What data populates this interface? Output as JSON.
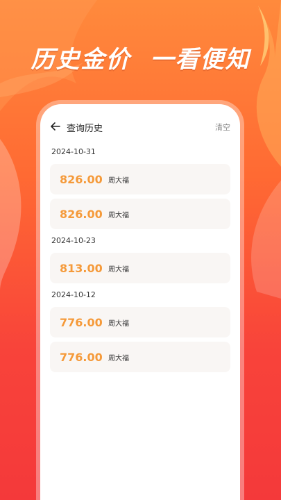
{
  "headline": {
    "part1": "历史金价",
    "part2": "一看便知"
  },
  "topbar": {
    "title": "查询历史",
    "clear_label": "清空"
  },
  "history": [
    {
      "date": "2024-10-31",
      "items": [
        {
          "price": "826.00",
          "brand": "周大福"
        },
        {
          "price": "826.00",
          "brand": "周大福"
        }
      ]
    },
    {
      "date": "2024-10-23",
      "items": [
        {
          "price": "813.00",
          "brand": "周大福"
        }
      ]
    },
    {
      "date": "2024-10-12",
      "items": [
        {
          "price": "776.00",
          "brand": "周大福"
        },
        {
          "price": "776.00",
          "brand": "周大福"
        }
      ]
    }
  ],
  "colors": {
    "price": "#f59a3a",
    "bg_top": "#ff8a3c",
    "bg_bottom": "#f4393a"
  }
}
